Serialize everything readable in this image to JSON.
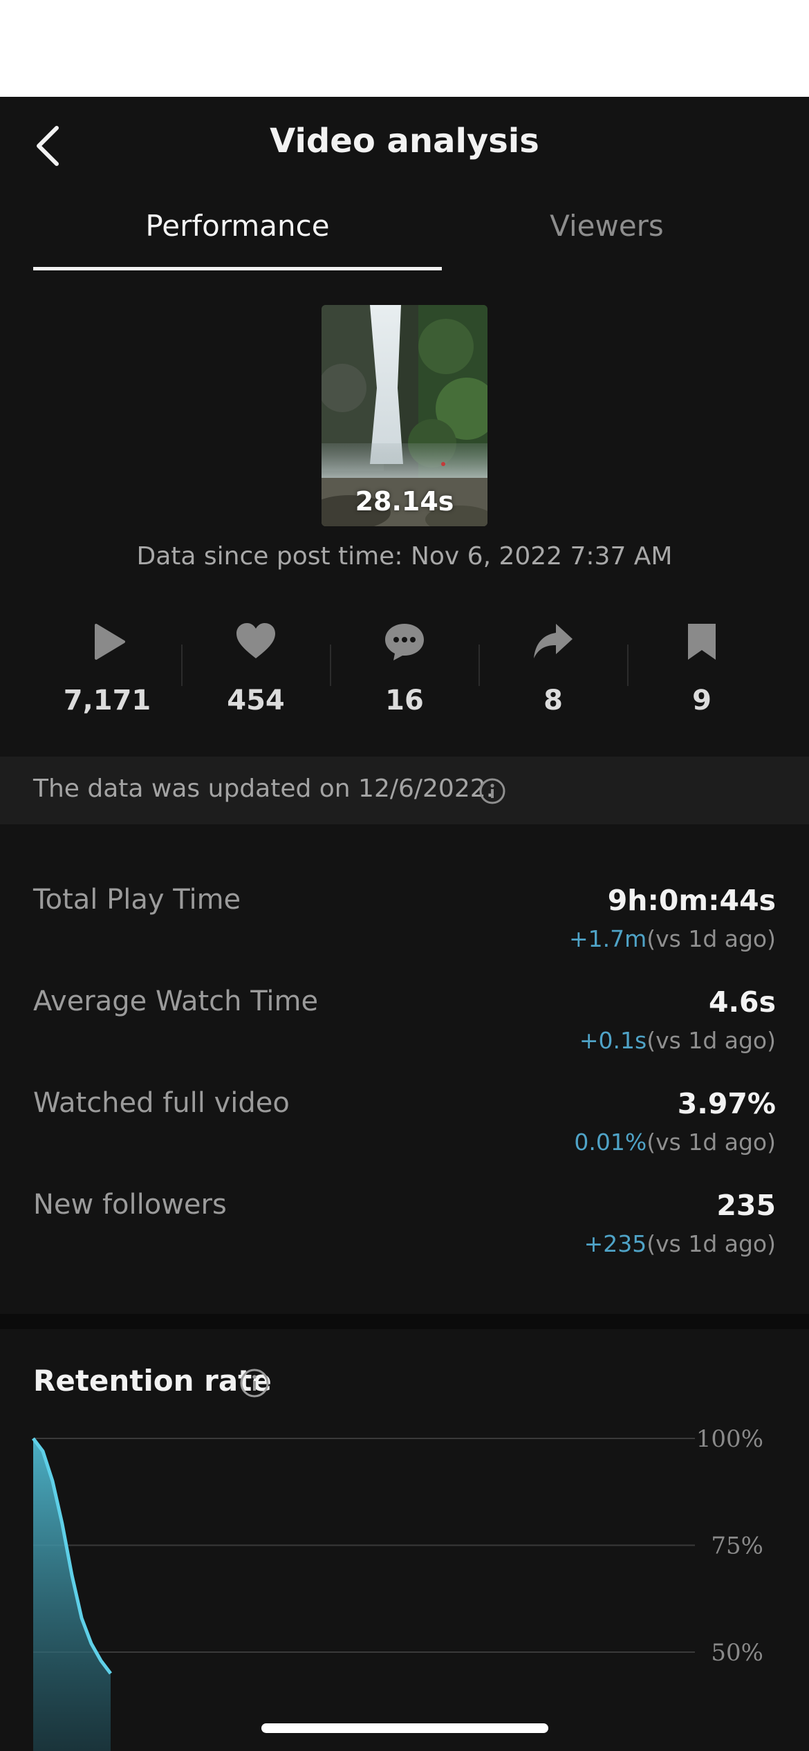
{
  "header": {
    "title": "Video analysis"
  },
  "tabs": [
    {
      "label": "Performance",
      "active": true
    },
    {
      "label": "Viewers",
      "active": false
    }
  ],
  "video": {
    "duration": "28.14s",
    "data_since": "Data since post time: Nov 6, 2022 7:37 AM"
  },
  "stats": [
    {
      "icon": "play-icon",
      "value": "7,171"
    },
    {
      "icon": "heart-icon",
      "value": "454"
    },
    {
      "icon": "comment-icon",
      "value": "16"
    },
    {
      "icon": "share-icon",
      "value": "8"
    },
    {
      "icon": "bookmark-icon",
      "value": "9"
    }
  ],
  "notice": {
    "text": "The data was updated on 12/6/2022."
  },
  "metrics": [
    {
      "label": "Total Play Time",
      "value": "9h:0m:44s",
      "delta": "+1.7m",
      "compare": "(vs 1d ago)"
    },
    {
      "label": "Average Watch Time",
      "value": "4.6s",
      "delta": "+0.1s",
      "compare": "(vs 1d ago)"
    },
    {
      "label": "Watched full video",
      "value": "3.97%",
      "delta": "0.01%",
      "compare": "(vs 1d ago)"
    },
    {
      "label": "New followers",
      "value": "235",
      "delta": "+235",
      "compare": "(vs 1d ago)"
    }
  ],
  "retention": {
    "title": "Retention rate"
  },
  "colors": {
    "accent": "#4fa3c7",
    "chart_line": "#5fd0e8",
    "background": "#131313"
  },
  "chart_data": {
    "type": "area",
    "title": "Retention rate",
    "y_ticks": [
      "100%",
      "75%",
      "50%"
    ],
    "ylim": [
      50,
      100
    ],
    "series": [
      {
        "values": [
          100,
          97,
          90,
          80,
          68,
          58,
          52,
          48,
          45
        ]
      }
    ],
    "grid": true
  }
}
